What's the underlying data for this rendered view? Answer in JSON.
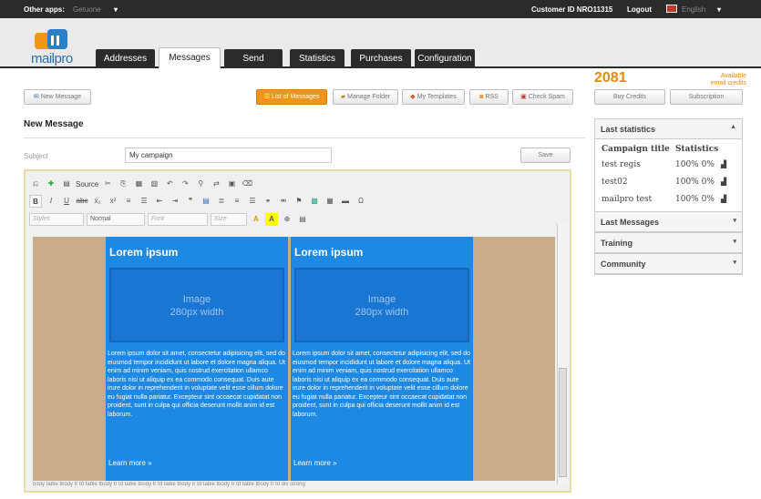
{
  "topbar": {
    "other_apps_label": "Other apps:",
    "other_apps_value": "Getuone",
    "customer_id": "Customer ID NRO11315",
    "logout": "Logout",
    "language": "English"
  },
  "header": {
    "logo_text": "mailpro",
    "tabs": [
      "Addresses",
      "Messages",
      "Send",
      "Statistics",
      "Purchases",
      "Configuration"
    ]
  },
  "toolbar": {
    "new_message": "New Message",
    "list_of_messages": "List of Messages",
    "manage_folder": "Manage Folder",
    "my_templates": "My Templates",
    "rss": "RSS",
    "check_spam": "Check Spam"
  },
  "credits": {
    "count": "2081",
    "available_line1": "Available",
    "available_line2": "email credits",
    "buy": "Buy Credits",
    "subscription": "Subscription"
  },
  "form": {
    "title": "New Message",
    "subject_label": "Subject",
    "subject_value": "My campaign",
    "save": "Save"
  },
  "editor": {
    "source_label": "Source",
    "styles": "Styles",
    "normal": "Normal",
    "font": "Font",
    "size": "Size",
    "block": {
      "heading": "Lorem ipsum",
      "image_line1": "Image",
      "image_line2": "280px width",
      "text": "Lorem ipsum dolor sit amet, consectetur adipisicing elit, sed do eiusmod tempor incididunt ut labore et dolore magna aliqua. Ut enim ad minim veniam, quis nostrud exercitation ullamco laboris nisi ut aliquip ex ea commodo consequat. Duis aute irure dolor in reprehenderit in voluptate velit esse cillum dolore eu fugiat nulla pariatur. Excepteur sint occaecat cupidatat non proident, sunt in culpa qui officia deserunt mollit anim id est laborum.",
      "more": "Learn more »"
    },
    "statusbar": "body table tbody tr td table tbody tr td table tbody tr td table tbody tr td table tbody tr td table tbody tr td div strong"
  },
  "sidebar": {
    "last_statistics": "Last statistics",
    "col_title": "Campaign title",
    "col_stats": "Statistics",
    "rows": [
      {
        "title": "test regis",
        "stats": "100% 0%"
      },
      {
        "title": "test02",
        "stats": "100% 0%"
      },
      {
        "title": "mailpro test",
        "stats": "100% 0%"
      }
    ],
    "last_messages": "Last Messages",
    "training": "Training",
    "community": "Community"
  },
  "colors": {
    "accent_orange": "#f0951a",
    "block_blue": "#1e88e5",
    "dark_bar": "#2b2b2b"
  }
}
